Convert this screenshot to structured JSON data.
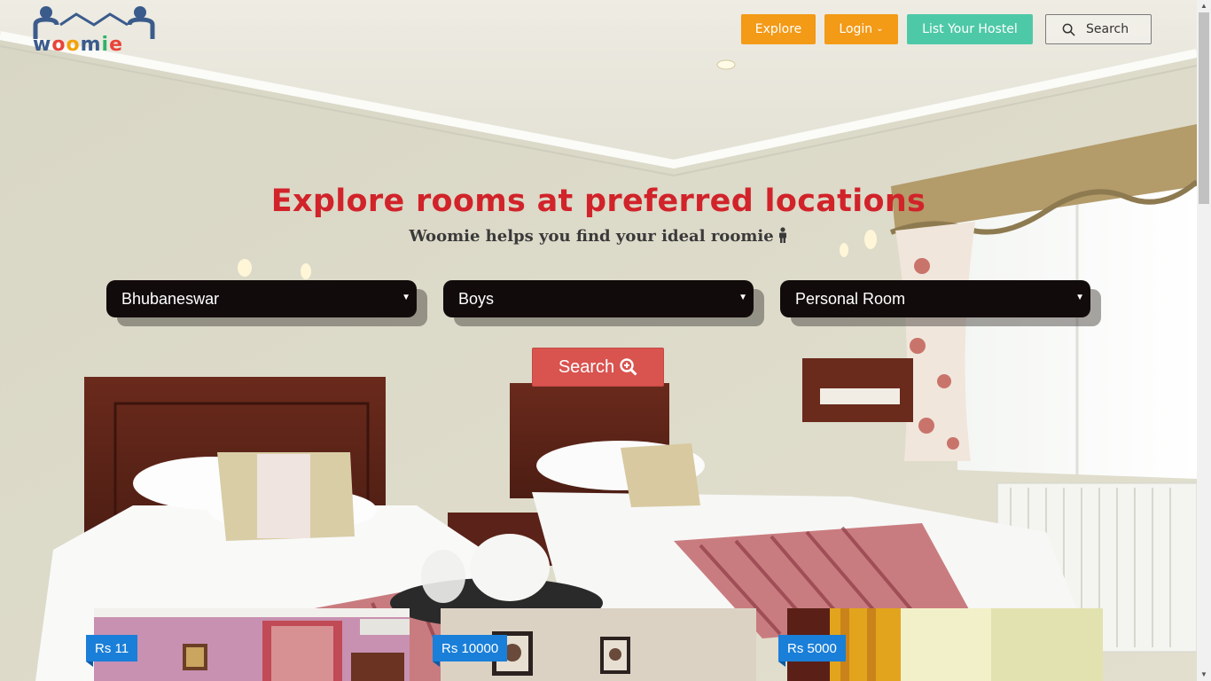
{
  "brand": {
    "logo_letters": [
      "w",
      "o",
      "o",
      "m",
      "i",
      "e"
    ]
  },
  "nav": {
    "explore": "Explore",
    "login": "Login",
    "list_hostel": "List Your Hostel",
    "search": "Search"
  },
  "hero": {
    "title": "Explore rooms at preferred locations",
    "subtitle": "Woomie helps you find your ideal roomie"
  },
  "filters": {
    "city": "Bhubaneswar",
    "gender": "Boys",
    "room_type": "Personal Room"
  },
  "search_button": "Search",
  "listings": [
    {
      "price": "Rs 11"
    },
    {
      "price": "Rs 10000"
    },
    {
      "price": "Rs 5000"
    }
  ],
  "colors": {
    "accent_orange": "#f39a17",
    "accent_teal": "#4ec9a7",
    "title_red": "#d1232a",
    "search_red": "#d9534f",
    "price_blue": "#1a7fd8"
  }
}
